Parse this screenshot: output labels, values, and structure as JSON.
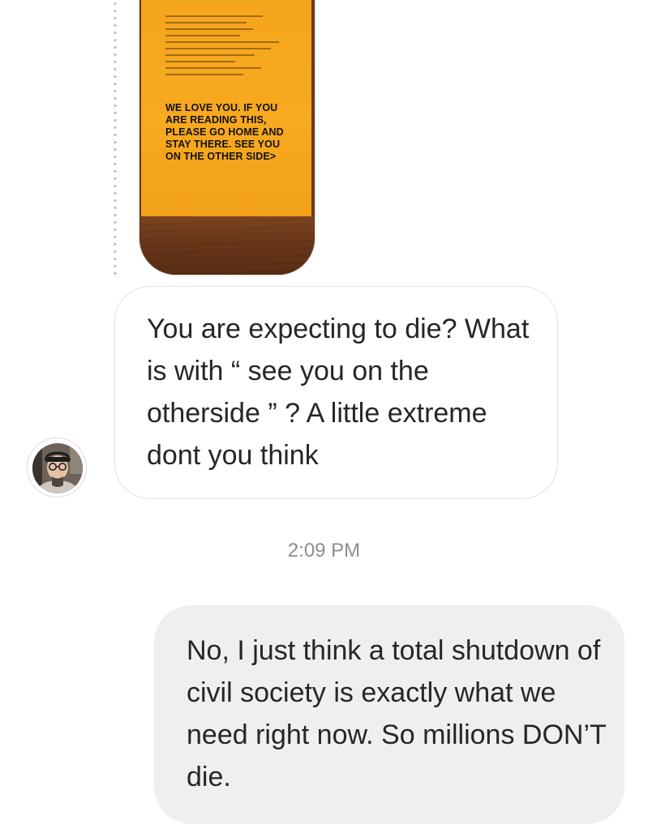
{
  "thread": {
    "shared_photo": {
      "icon": "photo-image",
      "sign_text": "WE LOVE YOU. IF YOU ARE READING THIS, PLEASE GO HOME AND STAY THERE. SEE YOU ON THE OTHER SIDE>"
    },
    "incoming_message": {
      "text": "You are expecting to die? What is with “ see you on the otherside ” ? A little extreme dont you think",
      "avatar_icon": "user-avatar"
    },
    "timestamp": "2:09 PM",
    "outgoing_message": {
      "text": "No, I just think a total shutdown of civil society is exactly what we need right now. So millions DON’T die."
    }
  },
  "colors": {
    "incoming_bubble_border": "#e2e2e2",
    "outgoing_bubble_bg": "#efefef",
    "timestamp": "#8e8e8e",
    "sign_paper": "#f7a91f"
  }
}
